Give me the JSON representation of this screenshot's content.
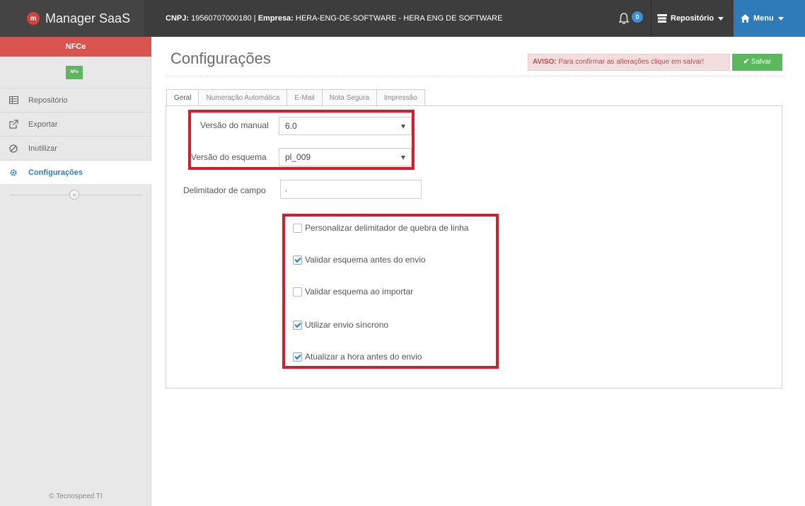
{
  "topbar": {
    "brand_name": "Manager SaaS",
    "brand_logo_letter": "m",
    "cnpj_label": "CNPJ:",
    "cnpj_value": "19560707000180 |",
    "empresa_label": "Empresa:",
    "empresa_value": "HERA-ENG-DE-SOFTWARE - HERA ENG DE SOFTWARE",
    "notification_count": "0",
    "repositorio_label": "Repositório",
    "menu_label": "Menu"
  },
  "sidebar": {
    "nfce_label": "NFCe",
    "nfe_label": "NFe",
    "items": [
      {
        "label": "Repositório",
        "icon": "grid-icon"
      },
      {
        "label": "Exportar",
        "icon": "external-link-icon"
      },
      {
        "label": "Inutilizar",
        "icon": "ban-icon"
      },
      {
        "label": "Configurações",
        "icon": "gear-icon",
        "active": true
      }
    ],
    "collapse_symbol": "«",
    "copyright": "© Tecnospeed TI"
  },
  "main": {
    "title": "Configurações",
    "aviso_label": "AVISO:",
    "aviso_text": "Para confirmar as alterações clique em salvar!",
    "save_label": "Salvar",
    "tabs": [
      "Geral",
      "Numeração Automática",
      "E-Mail",
      "Nota Segura",
      "Impressão"
    ],
    "active_tab": "Geral"
  },
  "form": {
    "versao_manual_label": "Versão do manual",
    "versao_manual_value": "6.0",
    "versao_esquema_label": "Versão do esquema",
    "versao_esquema_value": "pl_009",
    "delimitador_label": "Delimitador de campo",
    "delimitador_value": ",",
    "checkboxes": [
      {
        "label": "Personalizar delimitador de quebra de linha",
        "checked": false
      },
      {
        "label": "Validar esquema antes do envio",
        "checked": true
      },
      {
        "label": "Validar esquema ao importar",
        "checked": false
      },
      {
        "label": "Utilizar envio síncrono",
        "checked": true
      },
      {
        "label": "Atualizar a hora antes do envio",
        "checked": true
      }
    ]
  },
  "colors": {
    "highlight": "#d01f2e",
    "brand_red": "#d9534f",
    "menu_blue": "#2f7ab8",
    "save_green": "#5cb85c"
  }
}
